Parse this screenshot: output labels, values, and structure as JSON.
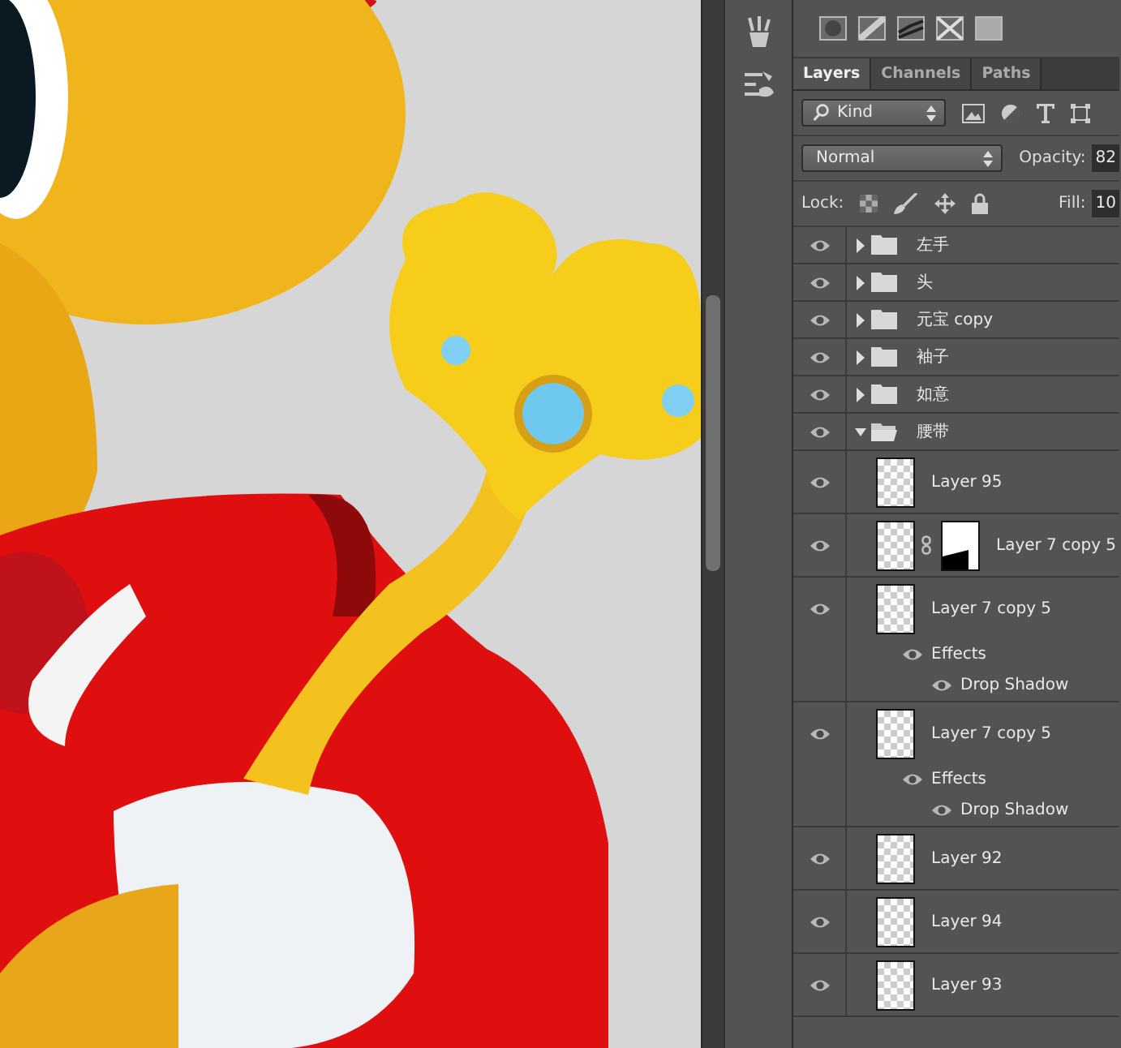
{
  "tabs": [
    {
      "label": "Layers",
      "selected": true
    },
    {
      "label": "Channels",
      "selected": false
    },
    {
      "label": "Paths",
      "selected": false
    }
  ],
  "filter": {
    "value": "Kind"
  },
  "blend_mode": {
    "value": "Normal"
  },
  "opacity": {
    "label": "Opacity:",
    "value": "82"
  },
  "lock": {
    "label": "Lock:"
  },
  "fill": {
    "label": "Fill:",
    "value": "10"
  },
  "layers": [
    {
      "kind": "group",
      "name": "左手",
      "visible": true,
      "expanded": false
    },
    {
      "kind": "group",
      "name": "头",
      "visible": true,
      "expanded": false
    },
    {
      "kind": "group",
      "name": "元宝 copy",
      "visible": true,
      "expanded": false
    },
    {
      "kind": "group",
      "name": "袖子",
      "visible": true,
      "expanded": false
    },
    {
      "kind": "group",
      "name": "如意",
      "visible": true,
      "expanded": false
    },
    {
      "kind": "group",
      "name": "腰带",
      "visible": true,
      "expanded": true,
      "children": [
        {
          "kind": "layer",
          "name": "Layer 95",
          "visible": true
        },
        {
          "kind": "masked",
          "name": "Layer 7 copy 5",
          "visible": true
        },
        {
          "kind": "layer",
          "name": "Layer 7 copy 5",
          "visible": true,
          "effects": {
            "label": "Effects",
            "visible": true,
            "items": [
              {
                "name": "Drop Shadow",
                "visible": true
              }
            ]
          }
        },
        {
          "kind": "layer",
          "name": "Layer 7 copy 5",
          "visible": true,
          "effects": {
            "label": "Effects",
            "visible": true,
            "items": [
              {
                "name": "Drop Shadow",
                "visible": true
              }
            ]
          }
        },
        {
          "kind": "layer",
          "name": "Layer 92",
          "visible": true
        },
        {
          "kind": "layer",
          "name": "Layer 94",
          "visible": true
        },
        {
          "kind": "layer",
          "name": "Layer 93",
          "visible": true
        }
      ]
    }
  ]
}
